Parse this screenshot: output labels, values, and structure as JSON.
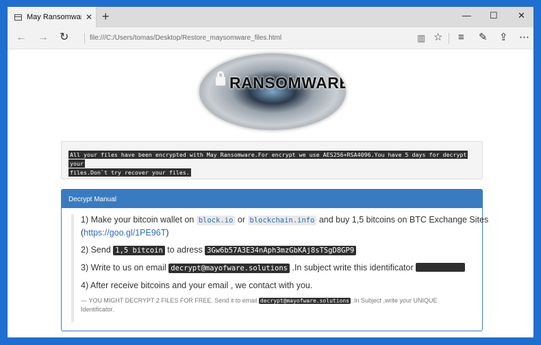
{
  "browser": {
    "tab_title": "May Ransomware Decry",
    "tab_close": "✕",
    "new_tab": "+",
    "url": "file:///C:/Users/tomas/Desktop/Restore_maysomware_files.html",
    "minimize": "—",
    "maximize": "☐",
    "close": "✕"
  },
  "banner": {
    "text": "RANSOMWARE"
  },
  "alert": {
    "line1": "All your files have been encrypted with May Ransomware.For encrypt we use AES256+RSA4096.You have 5 days for decrypt your",
    "line2": "files.Don`t try recover your files."
  },
  "manual": {
    "title": "Decrypt Manual",
    "s1_pre": "1) Make your bitcoin wallet on",
    "s1_site1": "block.io",
    "s1_or": "or",
    "s1_site2": "blockchain.info",
    "s1_post": "and buy 1,5 bitcoins on BTC Exchange Sites",
    "s1_link_open": "(",
    "s1_link": "https://goo.gl/1PE96T",
    "s1_link_close": ")",
    "s2_pre": "2) Send",
    "s2_amount": "1,5 bitcoin",
    "s2_mid": "to adress",
    "s2_address": "3Gw6b57A3E34nAph3mzGbKAj8sTSgD8GP9",
    "s3_pre": "3) Write to us on email",
    "s3_email": "decrypt@mayofware.solutions",
    "s3_post": ".In subject write this identificator",
    "s4": "4) After receive bitcoins and your email , we contact with you.",
    "note_pre": "— YOU MIGHT DECRYPT 2 FILES FOR FREE. Send it to email",
    "note_email": "decrypt@mayofware.solutions",
    "note_post": ".In Subject ,write your UNIQUE",
    "note_line2": "Identificator."
  }
}
